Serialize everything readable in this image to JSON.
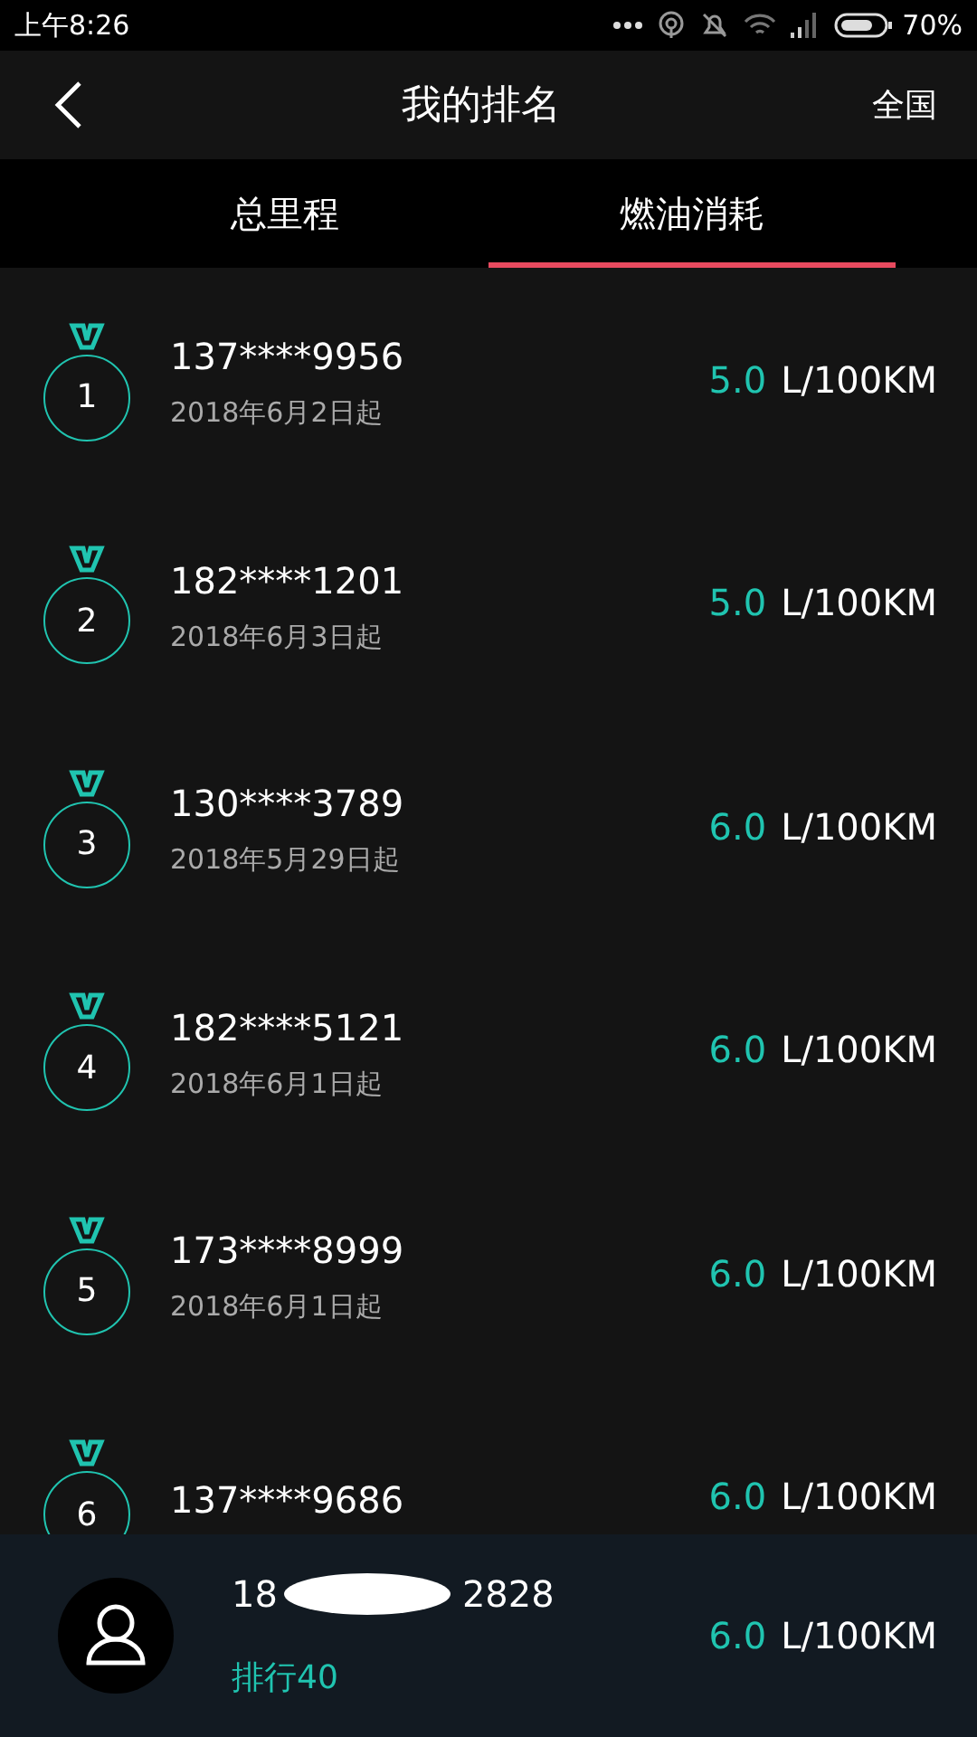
{
  "status_bar": {
    "time": "上午8:26",
    "battery": "70%"
  },
  "header": {
    "title": "我的排名",
    "scope": "全国"
  },
  "tabs": [
    {
      "label": "总里程",
      "selected": false
    },
    {
      "label": "燃油消耗",
      "selected": true
    }
  ],
  "rankings": [
    {
      "rank": "1",
      "name": "137****9956",
      "since": "2018年6月2日起",
      "value": "5.0",
      "unit": "L/100KM"
    },
    {
      "rank": "2",
      "name": "182****1201",
      "since": "2018年6月3日起",
      "value": "5.0",
      "unit": "L/100KM"
    },
    {
      "rank": "3",
      "name": "130****3789",
      "since": "2018年5月29日起",
      "value": "6.0",
      "unit": "L/100KM"
    },
    {
      "rank": "4",
      "name": "182****5121",
      "since": "2018年6月1日起",
      "value": "6.0",
      "unit": "L/100KM"
    },
    {
      "rank": "5",
      "name": "173****8999",
      "since": "2018年6月1日起",
      "value": "6.0",
      "unit": "L/100KM"
    },
    {
      "rank": "6",
      "name": "137****9686",
      "value": "6.0",
      "unit": "L/100KM"
    }
  ],
  "my_rank": {
    "name_start": "18",
    "name_end": "2828",
    "rank": "排行40",
    "value": "6.0",
    "unit": "L/100KM"
  }
}
